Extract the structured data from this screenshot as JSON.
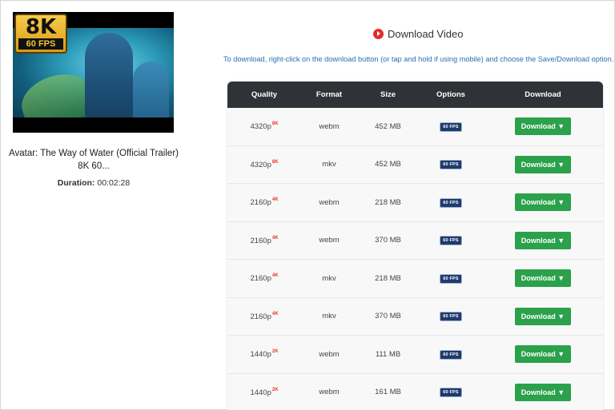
{
  "video": {
    "badge_resolution": "8K",
    "badge_fps": "60 FPS",
    "title": "Avatar: The Way of Water (Official Trailer) 8K 60...",
    "duration_label": "Duration:",
    "duration_value": "00:02:28"
  },
  "download": {
    "heading": "Download Video",
    "instructions": "To download, right-click on the download button (or tap and hold if using mobile) and choose the Save/Download option.",
    "columns": [
      "Quality",
      "Format",
      "Size",
      "Options",
      "Download"
    ],
    "rows": [
      {
        "quality": "4320p",
        "tag": "8K",
        "format": "webm",
        "size": "452 MB",
        "option": "60 FPS",
        "button": "Download ▼"
      },
      {
        "quality": "4320p",
        "tag": "8K",
        "format": "mkv",
        "size": "452 MB",
        "option": "60 FPS",
        "button": "Download ▼"
      },
      {
        "quality": "2160p",
        "tag": "4K",
        "format": "webm",
        "size": "218 MB",
        "option": "60 FPS",
        "button": "Download ▼"
      },
      {
        "quality": "2160p",
        "tag": "4K",
        "format": "webm",
        "size": "370 MB",
        "option": "60 FPS",
        "button": "Download ▼"
      },
      {
        "quality": "2160p",
        "tag": "4K",
        "format": "mkv",
        "size": "218 MB",
        "option": "60 FPS",
        "button": "Download ▼"
      },
      {
        "quality": "2160p",
        "tag": "4K",
        "format": "mkv",
        "size": "370 MB",
        "option": "60 FPS",
        "button": "Download ▼"
      },
      {
        "quality": "1440p",
        "tag": "2K",
        "format": "webm",
        "size": "111 MB",
        "option": "60 FPS",
        "button": "Download ▼"
      },
      {
        "quality": "1440p",
        "tag": "2K",
        "format": "webm",
        "size": "161 MB",
        "option": "60 FPS",
        "button": "Download ▼"
      }
    ]
  },
  "colors": {
    "button_green": "#2aa14a",
    "header_dark": "#2f3338",
    "link_blue": "#2a6fb0",
    "tag_red": "#e33333",
    "play_red": "#e22b2b"
  },
  "icons": {
    "heading_icon": "play-circle-icon",
    "button_icon": "caret-down-icon"
  }
}
